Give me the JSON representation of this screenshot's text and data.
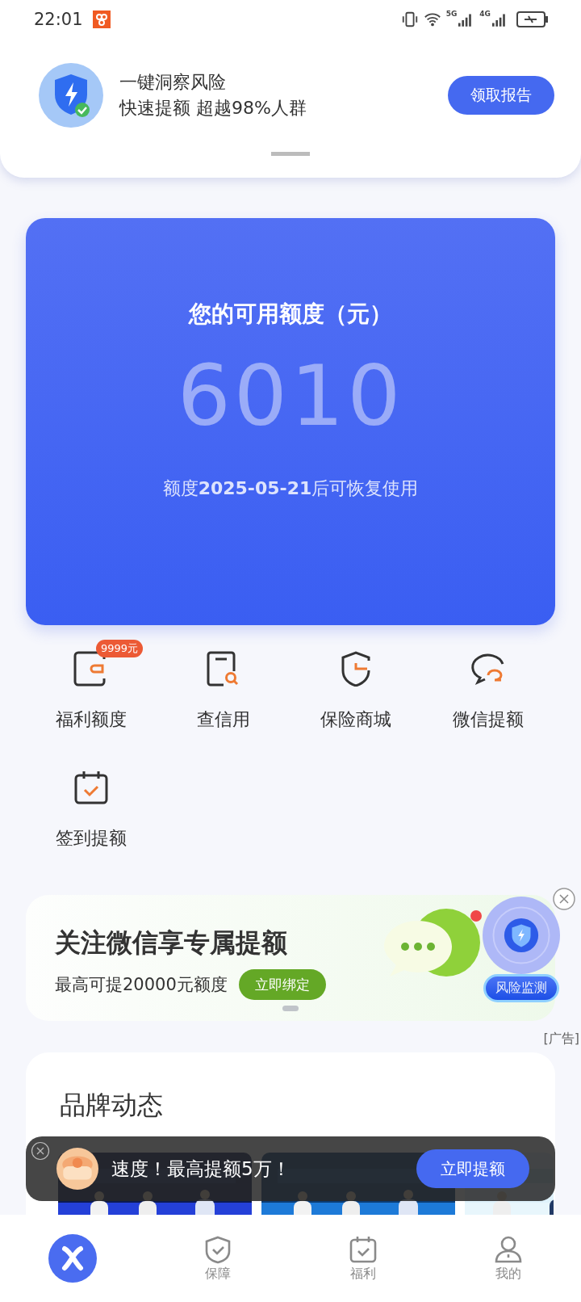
{
  "status_bar": {
    "time": "22:01",
    "network_5g": "5G",
    "network_4g": "4G"
  },
  "promo": {
    "title": "一键洞察风险",
    "subtitle": "快速提额 超越98%人群",
    "button": "领取报告"
  },
  "quota_card": {
    "title": "您的可用额度（元）",
    "amount": "6010",
    "note": "额度**2025-05-21**后可恢复使用"
  },
  "shortcuts": [
    {
      "kind": "wallet",
      "label": "福利额度",
      "badge": "9999元"
    },
    {
      "kind": "doc-search",
      "label": "查信用"
    },
    {
      "kind": "shield",
      "label": "保险商城"
    },
    {
      "kind": "chat",
      "label": "微信提额"
    },
    {
      "kind": "calendar",
      "label": "签到提额"
    }
  ],
  "wechat_banner": {
    "title": "关注微信享专属提额",
    "subtitle": "最高可提20000元额度",
    "button": "立即绑定",
    "risk_badge": "风险监测",
    "ad_label": "[广告]"
  },
  "brand_news": {
    "title": "品牌动态"
  },
  "float_ad": {
    "text": "速度！最高提额5万！",
    "button": "立即提额"
  },
  "nav": [
    {
      "kind": "logo",
      "selected": true
    },
    {
      "kind": "shield",
      "label": "保障",
      "selected": false
    },
    {
      "kind": "calendar",
      "label": "福利",
      "selected": false
    },
    {
      "kind": "person",
      "label": "我的",
      "selected": false
    }
  ]
}
